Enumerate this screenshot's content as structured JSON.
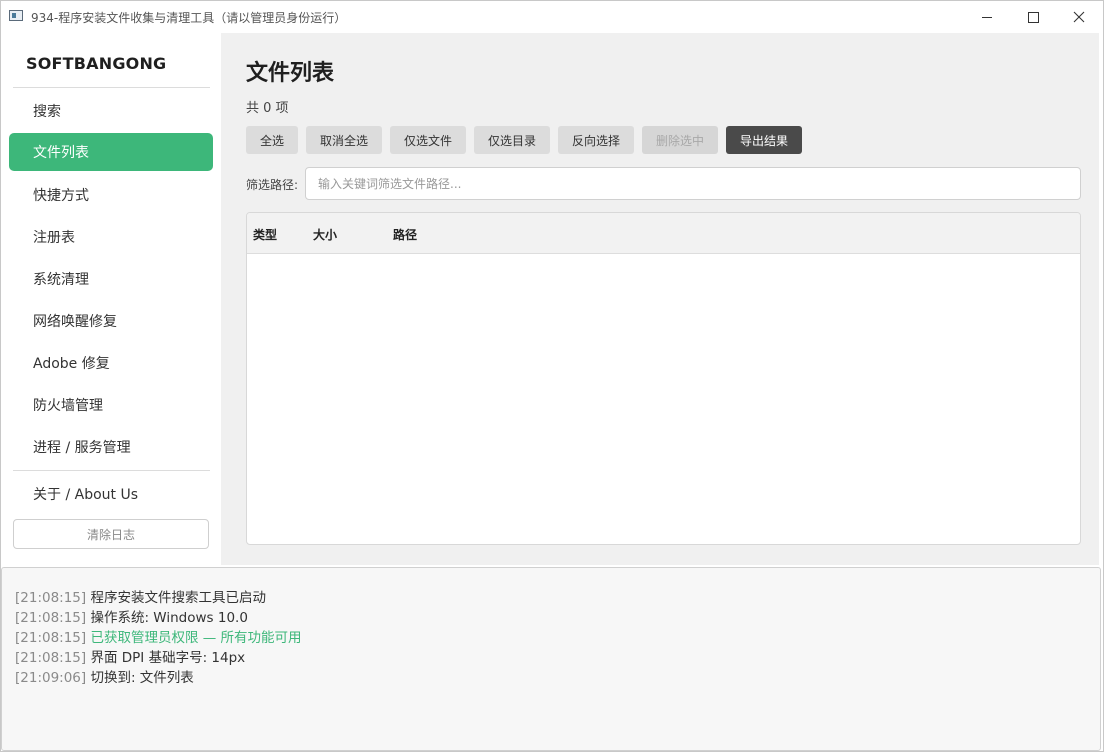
{
  "window": {
    "title": "934-程序安装文件收集与清理工具（请以管理员身份运行）"
  },
  "sidebar": {
    "brand": "SOFTBANGONG",
    "items": [
      {
        "label": "搜索",
        "active": false
      },
      {
        "label": "文件列表",
        "active": true
      },
      {
        "label": "快捷方式",
        "active": false
      },
      {
        "label": "注册表",
        "active": false
      },
      {
        "label": "系统清理",
        "active": false
      },
      {
        "label": "网络唤醒修复",
        "active": false
      },
      {
        "label": "Adobe 修复",
        "active": false
      },
      {
        "label": "防火墙管理",
        "active": false
      },
      {
        "label": "进程 / 服务管理",
        "active": false
      }
    ],
    "about_label": "关于 / About Us",
    "clear_log_label": "清除日志",
    "accent_color": "#3db77a"
  },
  "main": {
    "title": "文件列表",
    "count_text": "共 0 项",
    "toolbar": {
      "select_all": "全选",
      "deselect_all": "取消全选",
      "select_files": "仅选文件",
      "select_dirs": "仅选目录",
      "invert_selection": "反向选择",
      "delete_selected": "删除选中",
      "export_results": "导出结果"
    },
    "filter": {
      "label": "筛选路径:",
      "placeholder": "输入关键词筛选文件路径..."
    },
    "table": {
      "columns": [
        "类型",
        "大小",
        "路径"
      ],
      "rows": []
    }
  },
  "log": {
    "lines": [
      {
        "time": "[21:08:15]",
        "message": "程序安装文件搜索工具已启动",
        "status": "normal"
      },
      {
        "time": "[21:08:15]",
        "message": "操作系统: Windows 10.0",
        "status": "normal"
      },
      {
        "time": "[21:08:15]",
        "message": "已获取管理员权限 — 所有功能可用",
        "status": "success"
      },
      {
        "time": "[21:08:15]",
        "message": "界面 DPI 基础字号: 14px",
        "status": "normal"
      },
      {
        "time": "[21:09:06]",
        "message": "切换到: 文件列表",
        "status": "normal"
      }
    ]
  }
}
